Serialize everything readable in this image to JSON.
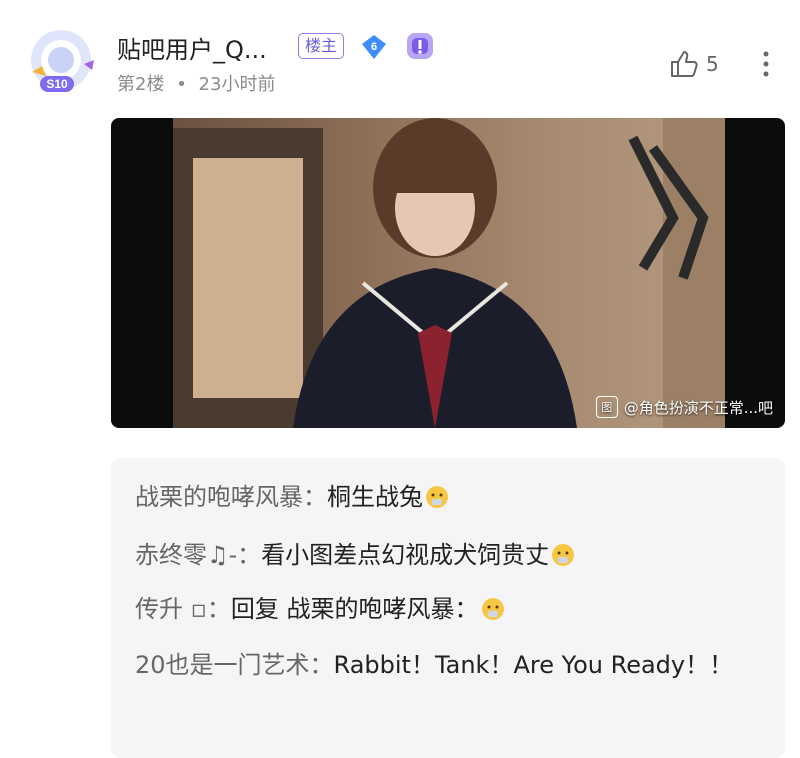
{
  "post": {
    "username": "贴吧用户_Q...",
    "owner_badge": "楼主",
    "level": "6",
    "avatar_tag": "S10",
    "floor": "第2楼",
    "separator": "•",
    "time": "23小时前",
    "likes": "5"
  },
  "media": {
    "watermark": "@角色扮演不正常...吧",
    "watermark_icon": "图"
  },
  "replies": [
    {
      "name": "战栗的咆哮风暴：",
      "text": "桐生战兔"
    },
    {
      "name": "赤终零♫-：",
      "text": "看小图差点幻视成犬饲贵丈"
    },
    {
      "name": "传升 ▫：",
      "text": "回复 战栗的咆哮风暴："
    },
    {
      "name": "20也是一门艺术：",
      "text": "Rabbit！Tank！Are You Ready！！"
    }
  ],
  "colors": {
    "accent": "#6a5fd6",
    "level_blue": "#3f8cff",
    "meta_gray": "#8b8b8b"
  }
}
